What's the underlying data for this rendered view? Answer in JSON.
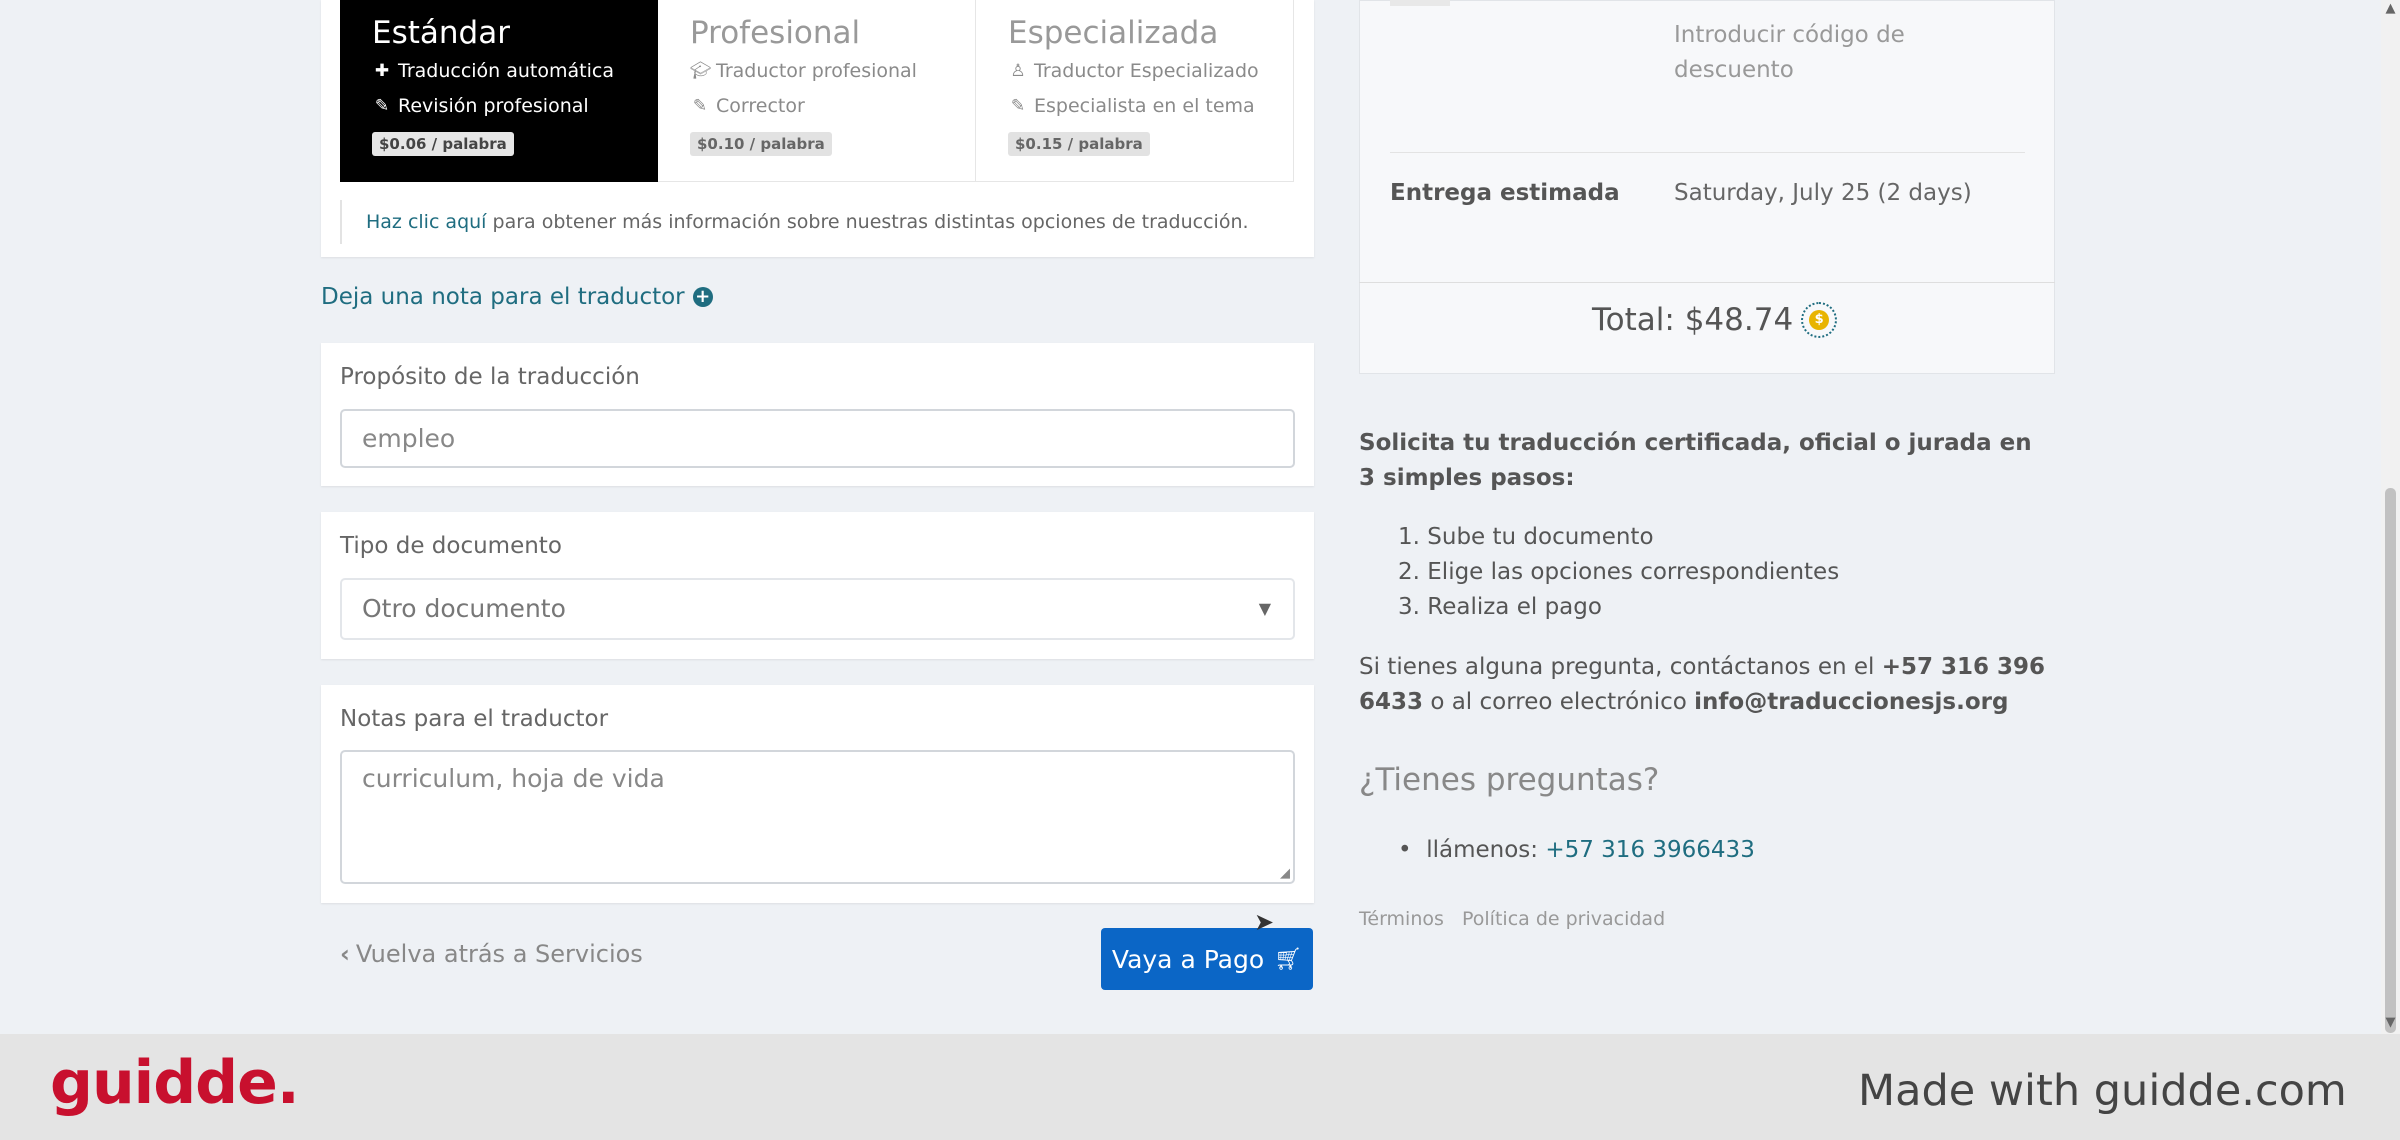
{
  "tiers": [
    {
      "title": "Estándar",
      "line1_icon": "robot-icon",
      "line1": "Traducción automática",
      "line2_icon": "edit-icon",
      "line2": "Revisión profesional",
      "price": "$0.06 / palabra",
      "selected": true
    },
    {
      "title": "Profesional",
      "line1_icon": "graduation-cap-icon",
      "line1": "Traductor profesional",
      "line2_icon": "edit-icon",
      "line2": "Corrector",
      "price": "$0.10 / palabra",
      "selected": false
    },
    {
      "title": "Especializada",
      "line1_icon": "user-tie-icon",
      "line1": "Traductor Especializado",
      "line2_icon": "edit-icon",
      "line2": "Especialista en el tema",
      "price": "$0.15 / palabra",
      "selected": false
    }
  ],
  "info": {
    "link": "Haz clic aquí",
    "rest": " para obtener más información sobre nuestras distintas opciones de traducción."
  },
  "note_toggle": {
    "label": "Deja una nota para el traductor",
    "icon": "plus-circle-icon"
  },
  "purpose": {
    "label": "Propósito de la traducción",
    "value": "empleo"
  },
  "doc_type": {
    "label": "Tipo de documento",
    "value": "Otro documento",
    "icon": "caret-down-icon"
  },
  "notes": {
    "label": "Notas para el traductor",
    "value": "curriculum, hoja de vida"
  },
  "back_link": {
    "label": "Vuelva atrás a Servicios",
    "icon": "chevron-left-icon"
  },
  "pay_button": {
    "label": "Vaya a Pago",
    "icon": "cart-icon"
  },
  "summary": {
    "discount_placeholder": "Introducir código de descuento",
    "delivery_label": "Entrega estimada",
    "delivery_value": "Saturday, July 25 (2 days)",
    "total": "Total: $48.74",
    "total_icon": "coin-icon"
  },
  "steps": {
    "heading": "Solicita tu traducción certificada, oficial o jurada en 3 simples pasos:",
    "items": [
      "Sube tu documento",
      "Elige las opciones correspondientes",
      "Realiza el pago"
    ]
  },
  "contact": {
    "prefix": "Si tienes alguna pregunta, contáctanos en el ",
    "phone": "+57 316 396 6433",
    "middle": " o al correo electrónico ",
    "email": "info@traduccionesjs.org"
  },
  "faq": {
    "heading": "¿Tienes preguntas?",
    "call_label": "llámenos: ",
    "call_phone": "+57 316 3966433"
  },
  "legal": {
    "terms": "Términos",
    "privacy": "Política de privacidad"
  },
  "branding": {
    "logo": "guidde.",
    "made_with": "Made with guidde.com"
  },
  "colors": {
    "accent": "#0b66c6",
    "link": "#1f6d80",
    "logo": "#c8102e"
  }
}
